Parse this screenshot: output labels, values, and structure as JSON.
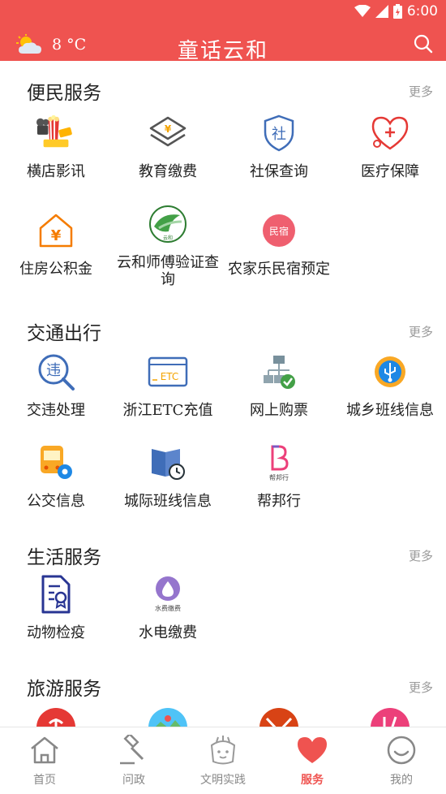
{
  "status_bar": {
    "time": "6:00"
  },
  "header": {
    "temperature": "8 °C",
    "title": "童话云和",
    "weather_icon": "partly-cloudy-icon",
    "search_icon": "search-icon"
  },
  "colors": {
    "brand": "#ef5350",
    "text": "#222222",
    "muted": "#9a9a9a"
  },
  "sections": [
    {
      "title": "便民服务",
      "more": "更多",
      "items": [
        {
          "label": "横店影讯",
          "icon": "cinema-icon"
        },
        {
          "label": "教育缴费",
          "icon": "education-fee-icon"
        },
        {
          "label": "社保查询",
          "icon": "social-security-icon"
        },
        {
          "label": "医疗保障",
          "icon": "medical-heart-icon"
        },
        {
          "label": "住房公积金",
          "icon": "housing-fund-icon"
        },
        {
          "label": "云和师傅验证查询",
          "icon": "yunhe-master-icon"
        },
        {
          "label": "农家乐民宿预定",
          "icon": "homestay-icon"
        }
      ]
    },
    {
      "title": "交通出行",
      "more": "更多",
      "items": [
        {
          "label": "交违处理",
          "icon": "traffic-violation-icon"
        },
        {
          "label": "浙江ETC充值",
          "icon": "etc-card-icon"
        },
        {
          "label": "网上购票",
          "icon": "ticket-network-icon"
        },
        {
          "label": "城乡班线信息",
          "icon": "usb-route-icon"
        },
        {
          "label": "公交信息",
          "icon": "bus-icon"
        },
        {
          "label": "城际班线信息",
          "icon": "intercity-book-icon"
        },
        {
          "label": "帮邦行",
          "icon": "bangbangxing-icon"
        }
      ]
    },
    {
      "title": "生活服务",
      "more": "更多",
      "items": [
        {
          "label": "动物检疫",
          "icon": "animal-quarantine-icon"
        },
        {
          "label": "水电缴费",
          "icon": "utility-fee-icon"
        }
      ]
    },
    {
      "title": "旅游服务",
      "more": "更多",
      "items": [
        {
          "label": "",
          "icon": "beach-icon"
        },
        {
          "label": "",
          "icon": "scenery-icon"
        },
        {
          "label": "",
          "icon": "tourism-logo-icon"
        },
        {
          "label": "",
          "icon": "food-icon"
        }
      ]
    }
  ],
  "badges": {
    "etc": "ETC",
    "homestay": "民宿",
    "bangbangxing": "帮邦行",
    "utility": "水费缴费"
  },
  "nav": [
    {
      "label": "首页",
      "icon": "home-icon",
      "active": false
    },
    {
      "label": "问政",
      "icon": "gavel-icon",
      "active": false
    },
    {
      "label": "文明实践",
      "icon": "civilization-icon",
      "active": false
    },
    {
      "label": "服务",
      "icon": "heart-icon",
      "active": true
    },
    {
      "label": "我的",
      "icon": "profile-smile-icon",
      "active": false
    }
  ]
}
